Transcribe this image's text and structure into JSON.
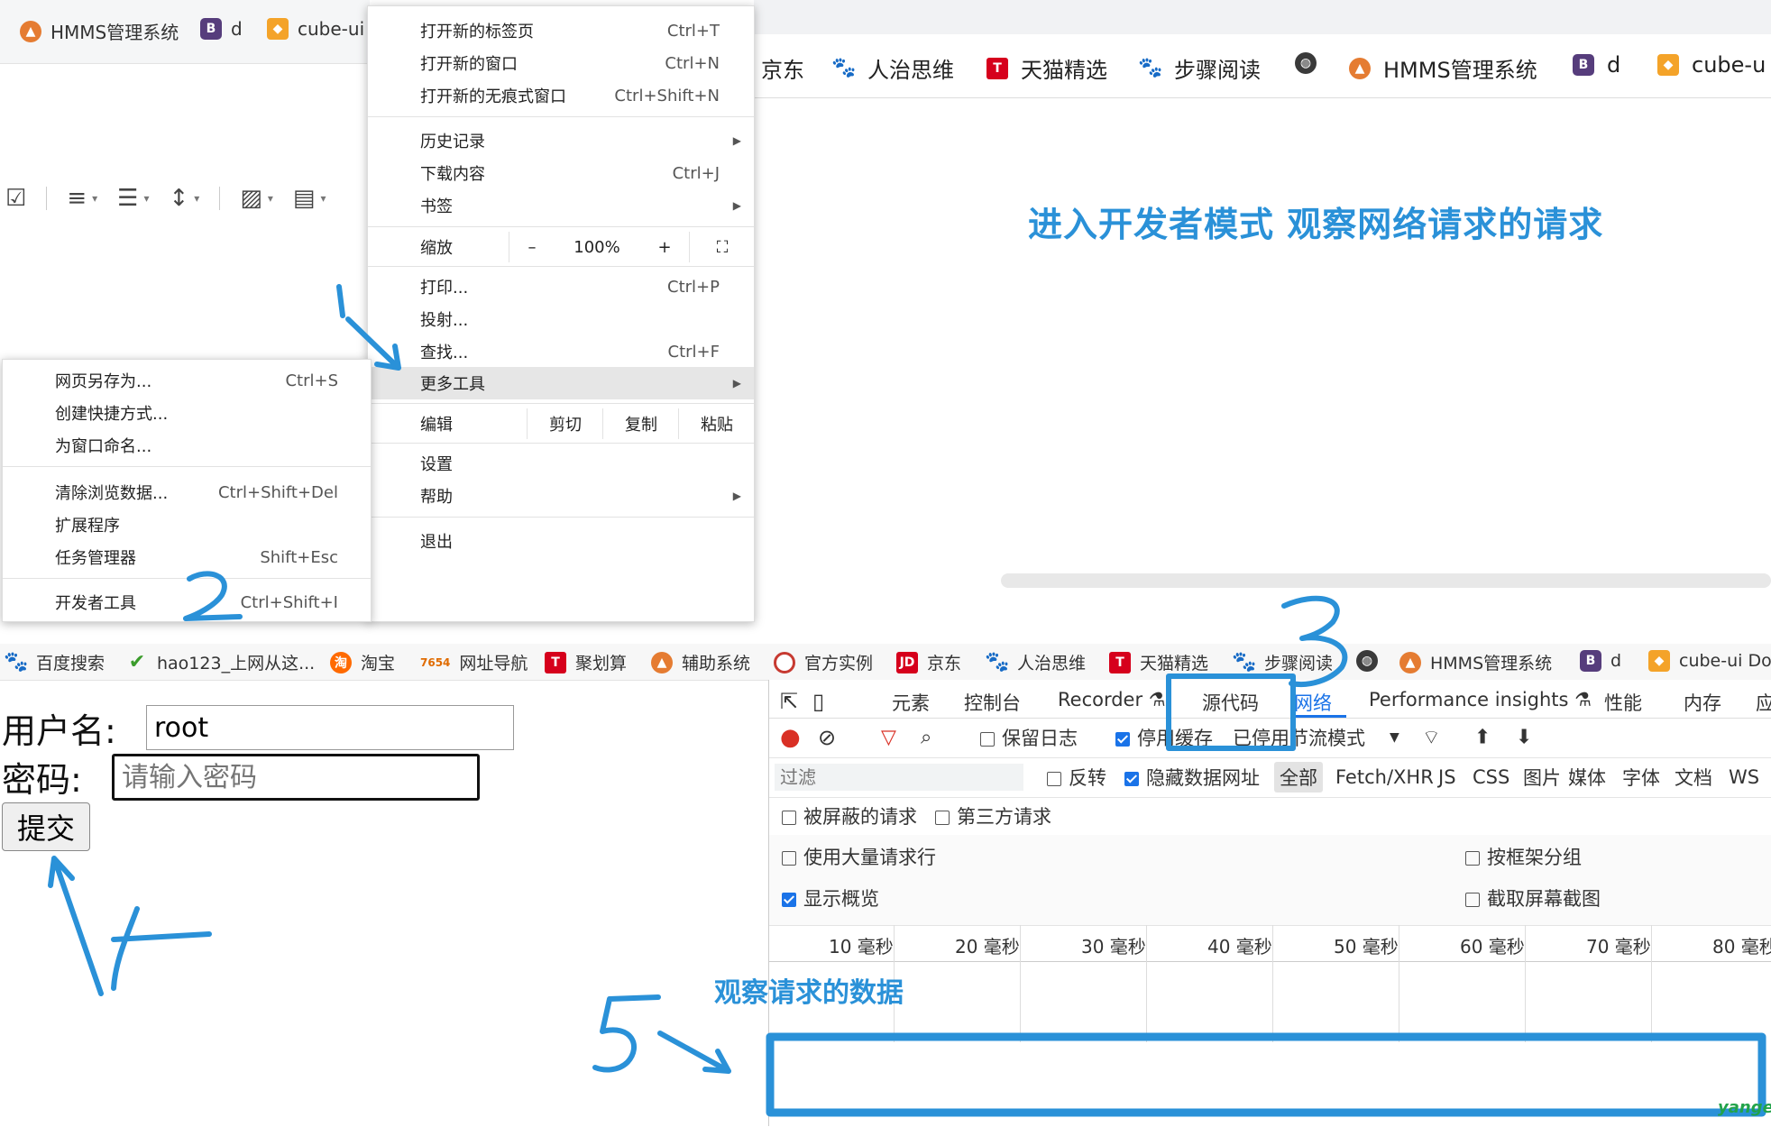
{
  "top_left_tabs": [
    {
      "label": "HMMS管理系统",
      "icon": "hmms-icon"
    },
    {
      "label": "d",
      "icon": "bootstrap-icon"
    },
    {
      "label": "cube-ui",
      "icon": "cube-icon"
    }
  ],
  "right_bookmarks": [
    {
      "label": "京东"
    },
    {
      "label": "人治思维",
      "icon": "paw-icon"
    },
    {
      "label": "天猫精选",
      "icon": "tmall-icon"
    },
    {
      "label": "步骤阅读",
      "icon": "paw-icon"
    },
    {
      "label": "",
      "icon": "globe-icon"
    },
    {
      "label": "HMMS管理系统",
      "icon": "hmms-icon"
    },
    {
      "label": "d",
      "icon": "bootstrap-icon"
    },
    {
      "label": "cube-u",
      "icon": "cube-icon"
    }
  ],
  "headline": "进入开发者模式 观察网络请求的请求",
  "chrome_menu": {
    "new_tab": {
      "label": "打开新的标签页",
      "shortcut": "Ctrl+T"
    },
    "new_window": {
      "label": "打开新的窗口",
      "shortcut": "Ctrl+N"
    },
    "incognito": {
      "label": "打开新的无痕式窗口",
      "shortcut": "Ctrl+Shift+N"
    },
    "history": {
      "label": "历史记录"
    },
    "downloads": {
      "label": "下载内容",
      "shortcut": "Ctrl+J"
    },
    "bookmarks": {
      "label": "书签"
    },
    "zoom": {
      "label": "缩放",
      "minus": "–",
      "value": "100%",
      "plus": "+",
      "fullscreen": "⛶"
    },
    "print": {
      "label": "打印...",
      "shortcut": "Ctrl+P"
    },
    "cast": {
      "label": "投射..."
    },
    "find": {
      "label": "查找...",
      "shortcut": "Ctrl+F"
    },
    "more_tools": {
      "label": "更多工具"
    },
    "edit": {
      "label": "编辑",
      "cut": "剪切",
      "copy": "复制",
      "paste": "粘贴"
    },
    "settings": {
      "label": "设置"
    },
    "help": {
      "label": "帮助"
    },
    "exit": {
      "label": "退出"
    }
  },
  "more_tools_submenu": {
    "save_page": {
      "label": "网页另存为...",
      "shortcut": "Ctrl+S"
    },
    "create_shortcut": {
      "label": "创建快捷方式..."
    },
    "name_window": {
      "label": "为窗口命名..."
    },
    "clear_data": {
      "label": "清除浏览数据...",
      "shortcut": "Ctrl+Shift+Del"
    },
    "extensions": {
      "label": "扩展程序"
    },
    "task_manager": {
      "label": "任务管理器",
      "shortcut": "Shift+Esc"
    },
    "devtools": {
      "label": "开发者工具",
      "shortcut": "Ctrl+Shift+I"
    }
  },
  "bottom_bookmarks": [
    {
      "label": "百度搜索",
      "icon": "paw-icon"
    },
    {
      "label": "hao123_上网从这...",
      "icon": "hao123-icon"
    },
    {
      "label": "淘宝",
      "icon": "taobao-icon"
    },
    {
      "label": "网址导航",
      "icon": "7654-icon"
    },
    {
      "label": "聚划算",
      "icon": "juhuasuan-icon"
    },
    {
      "label": "辅助系统",
      "icon": "hmms-icon"
    },
    {
      "label": "官方实例",
      "icon": "ring-icon"
    },
    {
      "label": "京东",
      "icon": "jd-icon"
    },
    {
      "label": "人治思维",
      "icon": "paw-icon"
    },
    {
      "label": "天猫精选",
      "icon": "tmall-icon"
    },
    {
      "label": "步骤阅读",
      "icon": "paw-icon"
    },
    {
      "label": "",
      "icon": "globe-icon"
    },
    {
      "label": "HMMS管理系统",
      "icon": "hmms-icon"
    },
    {
      "label": "d",
      "icon": "bootstrap-icon"
    },
    {
      "label": "cube-ui Do",
      "icon": "cube-icon"
    }
  ],
  "form": {
    "username_label": "用户名:",
    "username_value": "root",
    "password_label": "密码:",
    "password_placeholder": "请输入密码",
    "submit_label": "提交"
  },
  "devtools": {
    "tabs": [
      "元素",
      "控制台",
      "Recorder ⚗",
      "源代码",
      "网络",
      "Performance insights ⚗",
      "性能",
      "内存",
      "应"
    ],
    "active_tab": "网络",
    "toolbar": {
      "preserve_log": "保留日志",
      "disable_cache": "停用缓存",
      "throttle": "已停用节流模式"
    },
    "filter": {
      "placeholder": "过滤",
      "invert": "反转",
      "hide_data_urls": "隐藏数据网址",
      "types": [
        "全部",
        "Fetch/XHR",
        "JS",
        "CSS",
        "图片",
        "媒体",
        "字体",
        "文档",
        "WS"
      ]
    },
    "blocked_requests": "被屏蔽的请求",
    "third_party": "第三方请求",
    "large_rows": "使用大量请求行",
    "group_by_frame": "按框架分组",
    "show_overview": "显示概览",
    "capture_screenshots": "截取屏幕截图",
    "timeline_ticks": [
      "10 毫秒",
      "20 毫秒",
      "30 毫秒",
      "40 毫秒",
      "50 毫秒",
      "60 毫秒",
      "70 毫秒",
      "80 毫秒"
    ]
  },
  "annotations": {
    "step1": "1",
    "step2": "2",
    "step3": "3",
    "step4": "4",
    "step5": "5",
    "observe_label": "观察请求的数据"
  },
  "watermark": "yangeit",
  "colors": {
    "annotation_blue": "#2a91d8",
    "devtools_accent": "#1a73e8",
    "watermark": "#22a34a"
  }
}
